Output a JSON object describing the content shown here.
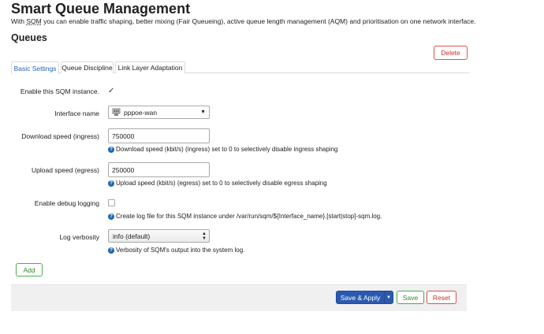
{
  "page": {
    "title": "Smart Queue Management",
    "description_pre": "With ",
    "description_abbr": "SQM",
    "description_post": " you can enable traffic shaping, better mixing (Fair Queueing), active queue length management (AQM) and prioritisation on one network interface.",
    "section_title": "Queues"
  },
  "actions": {
    "delete_label": "Delete",
    "add_label": "Add"
  },
  "tabs": [
    {
      "label": "Basic Settings",
      "active": true
    },
    {
      "label": "Queue Discipline",
      "active": false
    },
    {
      "label": "Link Layer Adaptation",
      "active": false
    }
  ],
  "form": {
    "enable": {
      "label": "Enable this SQM instance.",
      "checked": true
    },
    "interface": {
      "label": "Interface name",
      "value": "pppoe-wan",
      "icon": "network-interface-icon"
    },
    "download": {
      "label": "Download speed (ingress)",
      "value": "750000",
      "help": "Download speed (kbit/s) (ingress) set to 0 to selectively disable ingress shaping"
    },
    "upload": {
      "label": "Upload speed (egress)",
      "value": "250000",
      "help": "Upload speed (kbit/s) (egress) set to 0 to selectively disable egress shaping"
    },
    "debug": {
      "label": "Enable debug logging",
      "checked": false,
      "help": "Create log file for this SQM instance under /var/run/sqm/${Interface_name}.[start|stop]-sqm.log."
    },
    "verbosity": {
      "label": "Log verbosity",
      "value": "info (default)",
      "help": "Verbosity of SQM's output into the system log."
    }
  },
  "footer": {
    "save_apply_label": "Save & Apply",
    "save_label": "Save",
    "reset_label": "Reset"
  },
  "colors": {
    "primary": "#2a5aaf",
    "positive": "#4cae4c",
    "negative": "#d9534f",
    "active_tab": "#1e66b4"
  }
}
